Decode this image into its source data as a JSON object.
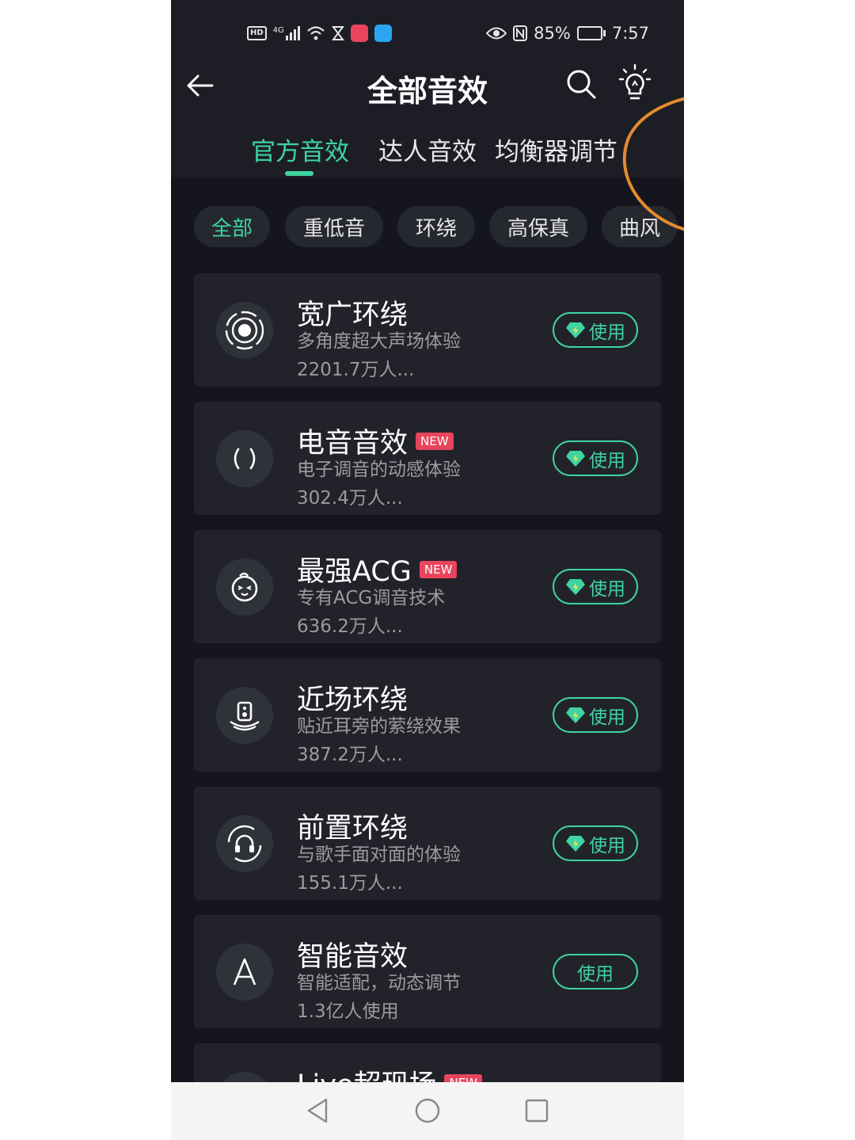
{
  "status_bar": {
    "left_hd": "HD",
    "left_net": "4G",
    "battery_percent": "85%",
    "battery_level": 0.85,
    "time": "7:57"
  },
  "header": {
    "title": "全部音效",
    "tabs": [
      {
        "label": "官方音效",
        "active": true
      },
      {
        "label": "达人音效",
        "active": false
      },
      {
        "label": "均衡器调节",
        "active": false
      }
    ]
  },
  "filters": [
    {
      "label": "全部",
      "active": true
    },
    {
      "label": "重低音",
      "active": false
    },
    {
      "label": "环绕",
      "active": false
    },
    {
      "label": "高保真",
      "active": false
    },
    {
      "label": "曲风",
      "active": false
    }
  ],
  "effects": [
    {
      "title": "宽广环绕",
      "badge": "",
      "desc": "多角度超大声场体验",
      "count": "2201.7万人...",
      "button": "使用",
      "icon": "surround-rings-icon"
    },
    {
      "title": "电音音效",
      "badge": "NEW",
      "desc": "电子调音的动感体验",
      "count": "302.4万人...",
      "button": "使用",
      "icon": "sound-waves-icon"
    },
    {
      "title": "最强ACG",
      "badge": "NEW",
      "desc": "专有ACG调音技术",
      "count": "636.2万人...",
      "button": "使用",
      "icon": "anime-face-icon"
    },
    {
      "title": "近场环绕",
      "badge": "",
      "desc": "贴近耳旁的萦绕效果",
      "count": "387.2万人...",
      "button": "使用",
      "icon": "speaker-icon"
    },
    {
      "title": "前置环绕",
      "badge": "",
      "desc": "与歌手面对面的体验",
      "count": "155.1万人...",
      "button": "使用",
      "icon": "headphones-icon"
    },
    {
      "title": "智能音效",
      "badge": "",
      "desc": "智能适配，动态调节",
      "count": "1.3亿人使用",
      "button": "使用",
      "icon": "letter-a-icon"
    },
    {
      "title": "Live超现场",
      "badge": "NEW",
      "desc": "",
      "count": "",
      "button": "",
      "icon": "live-icon"
    }
  ],
  "colors": {
    "accent": "#3ed4a0",
    "background": "#15161d",
    "card": "#22232a",
    "badge": "#e8455c",
    "annotation": "#e6892f"
  }
}
